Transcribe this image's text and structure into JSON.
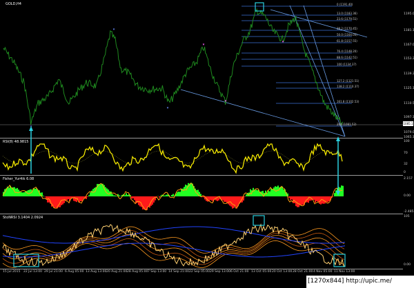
{
  "colors": {
    "background": "#000000",
    "price_line": "#1f8a1f",
    "rsi_line": "#f2e600",
    "fisher_up": "#22ff22",
    "fisher_down": "#ff1a1a",
    "fisher_line": "#ffa010",
    "fib_line": "#3d6fd6",
    "channel_line": "#6a9ee8",
    "marker": "#2ad0e0",
    "arrow": "#2ad0e0",
    "stoch_orange": "#ff9a20",
    "stoch_blue": "#2244ff",
    "stoch_yellow": "#ffd070"
  },
  "panes": {
    "main": {
      "title": "GOLD,H4"
    },
    "rsi": {
      "title": "RSI(8) 48.9815"
    },
    "fisher": {
      "title": "Fisher_Yur4ik 6.08"
    },
    "stoch": {
      "title": "StoNRSI 3.1404 2.0924"
    }
  },
  "fib_levels": [
    "0 (1191.40)",
    "13.0 (1183.36)",
    "23.6 (1179.51)",
    "38.2 (1170.45)",
    "50.0 (1164.05)",
    "61.8 (1157.55)",
    "76.4 (1148.20)",
    "88.6 (1142.51)",
    "100 (1134.37)",
    "127.2 (1121.51)",
    "138.2 (1110.37)",
    "161.8 (1102.53)",
    "200 (1081.52)"
  ],
  "price_axis": [
    "1195.0",
    "1181.1",
    "1167.0",
    "1153.3",
    "1139.3",
    "1125.1",
    "1110.5",
    "1097.1",
    "1079.0",
    "1065.1"
  ],
  "current_price": "1085.1",
  "rsi_axis": [
    "100",
    "70",
    "32",
    "0"
  ],
  "fisher_axis": [
    "2.157",
    "0.00",
    "-2.485"
  ],
  "stoch_axis": [
    "105",
    "0.00"
  ],
  "time_axis": [
    "15 Jul 2015",
    "22 Jul 13:00",
    "29 Jul 21:00",
    "6 Aug 05:00",
    "13 Aug 13:00",
    "20 Aug 21:00",
    "28 Aug 05:00",
    "7 Sep 13:00",
    "14 Sep 21:00",
    "22 Sep 05:00",
    "29 Sep 13:00",
    "6 Oct 21:00",
    "13 Oct 05:00",
    "20 Oct 13:00",
    "28 Oct 21:00",
    "4 Nov 05:00",
    "11 Nov 13:00"
  ],
  "footer": {
    "text": "[1270x844] http://upic.me/"
  }
}
